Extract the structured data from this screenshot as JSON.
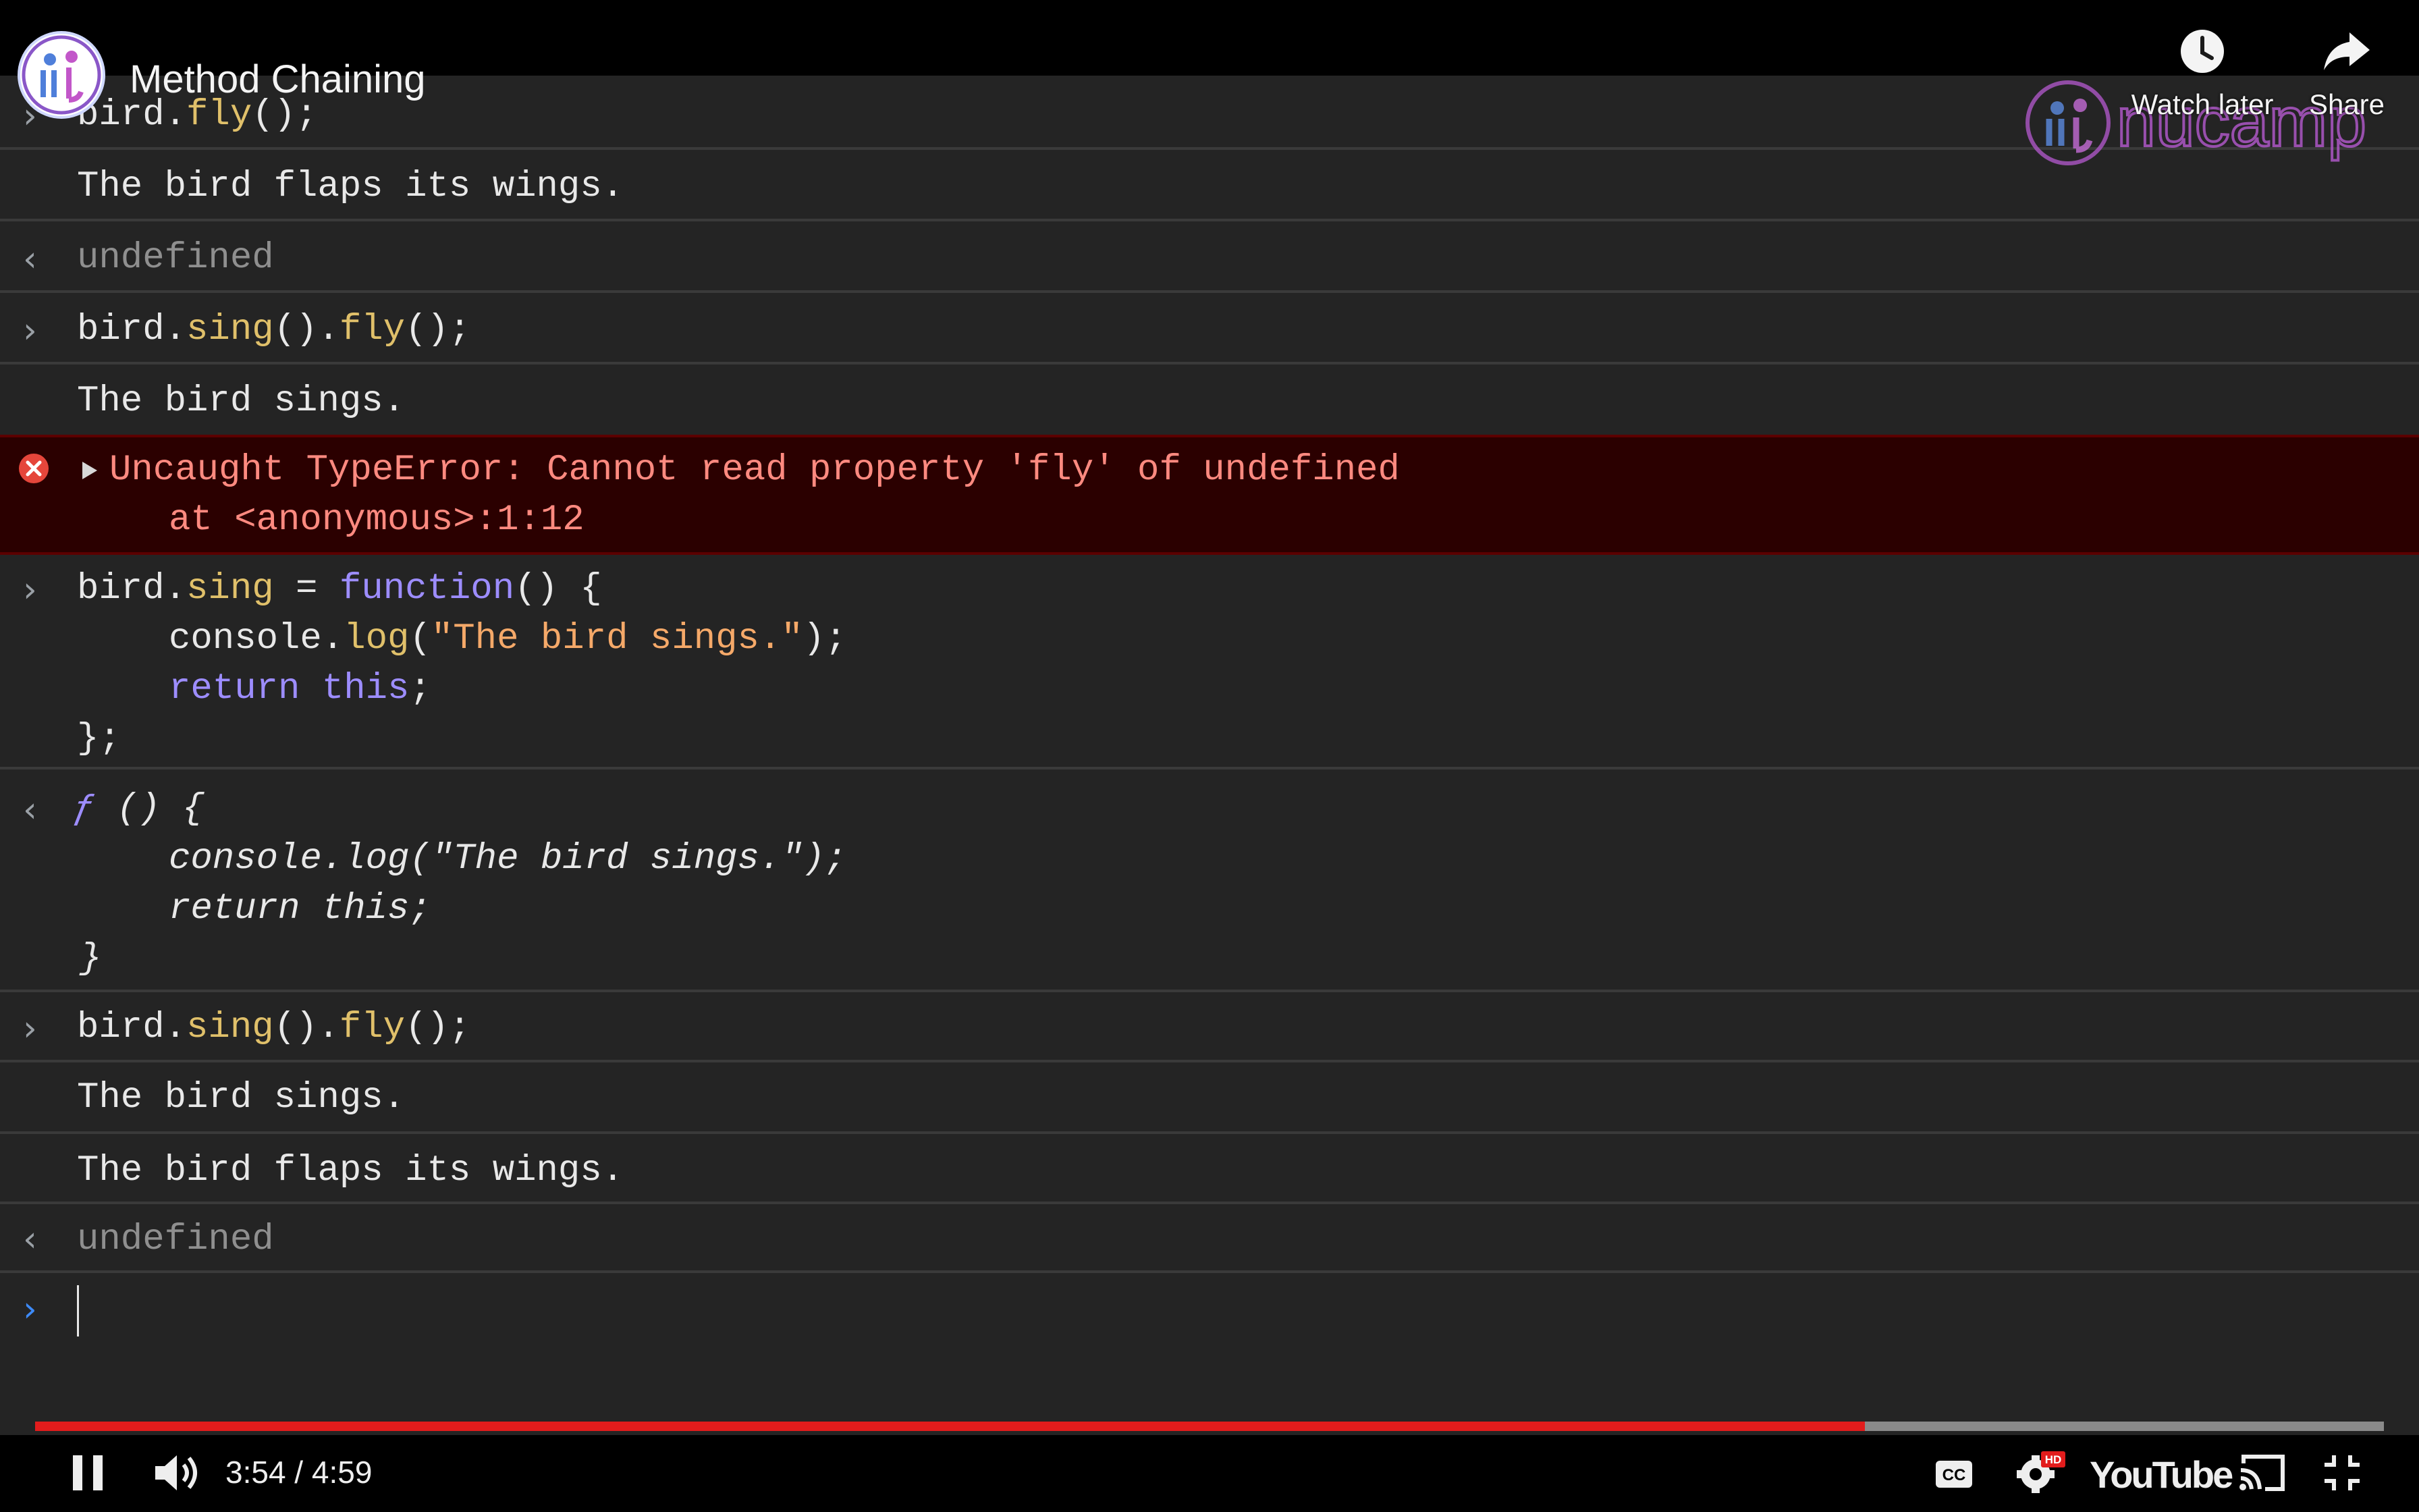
{
  "video": {
    "title": "Method Chaining",
    "watch_later_label": "Watch later",
    "share_label": "Share",
    "watermark_text": "nucamp",
    "time_current": "3:54",
    "time_separator": " / ",
    "time_total": "4:59",
    "progress_fraction": 0.779,
    "hd_badge": "HD",
    "youtube_wordmark": "YouTube",
    "colors": {
      "progress": "#e21c1c",
      "accent": "#c46bd6"
    }
  },
  "console": {
    "line1": {
      "obj": "bird.",
      "method": "fly",
      "rest": "();"
    },
    "output_fly_1": "The bird flaps its wings.",
    "undefined_1": "undefined",
    "line2": {
      "obj": "bird.",
      "m1": "sing",
      "mid": "().",
      "m2": "fly",
      "rest": "();"
    },
    "output_sing_1": "The bird sings.",
    "error_message": "Uncaught TypeError: Cannot read property 'fly' of undefined",
    "error_location": "at <anonymous>:1:12",
    "def": {
      "obj": "bird.",
      "method": "sing",
      "assign": " = ",
      "kw_function": "function",
      "sig": "() {",
      "body_obj": "console.",
      "body_log": "log",
      "paren_open": "(",
      "body_str": "\"The bird sings.\"",
      "paren_close": ");",
      "kw_return": "return",
      "kw_this": "this",
      "semi": ";",
      "close": "};"
    },
    "fn_result": {
      "f": "ƒ",
      "sig": " () {",
      "body1": "console.log(\"The bird sings.\");",
      "body2": "return this;",
      "close": "}"
    },
    "line3": {
      "obj": "bird.",
      "m1": "sing",
      "mid": "().",
      "m2": "fly",
      "rest": "();"
    },
    "output_sing_2": "The bird sings.",
    "output_fly_2": "The bird flaps its wings.",
    "undefined_2": "undefined"
  }
}
